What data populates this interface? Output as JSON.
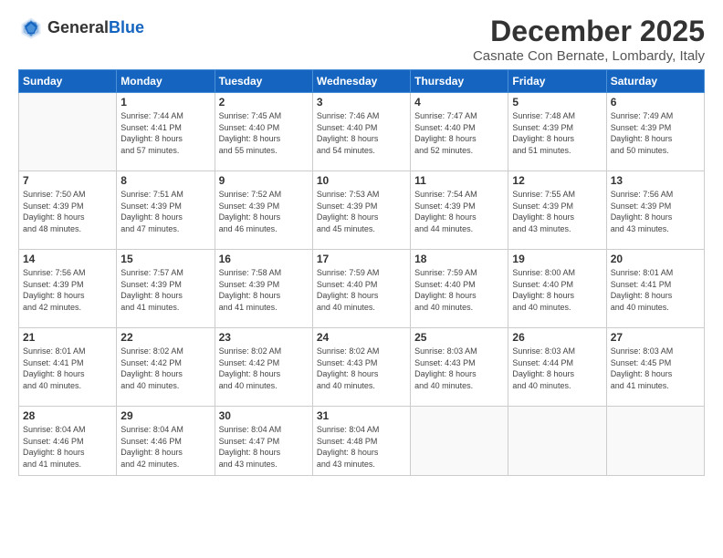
{
  "header": {
    "logo_general": "General",
    "logo_blue": "Blue",
    "month": "December 2025",
    "location": "Casnate Con Bernate, Lombardy, Italy"
  },
  "days_of_week": [
    "Sunday",
    "Monday",
    "Tuesday",
    "Wednesday",
    "Thursday",
    "Friday",
    "Saturday"
  ],
  "weeks": [
    [
      {
        "day": "",
        "info": ""
      },
      {
        "day": "1",
        "info": "Sunrise: 7:44 AM\nSunset: 4:41 PM\nDaylight: 8 hours\nand 57 minutes."
      },
      {
        "day": "2",
        "info": "Sunrise: 7:45 AM\nSunset: 4:40 PM\nDaylight: 8 hours\nand 55 minutes."
      },
      {
        "day": "3",
        "info": "Sunrise: 7:46 AM\nSunset: 4:40 PM\nDaylight: 8 hours\nand 54 minutes."
      },
      {
        "day": "4",
        "info": "Sunrise: 7:47 AM\nSunset: 4:40 PM\nDaylight: 8 hours\nand 52 minutes."
      },
      {
        "day": "5",
        "info": "Sunrise: 7:48 AM\nSunset: 4:39 PM\nDaylight: 8 hours\nand 51 minutes."
      },
      {
        "day": "6",
        "info": "Sunrise: 7:49 AM\nSunset: 4:39 PM\nDaylight: 8 hours\nand 50 minutes."
      }
    ],
    [
      {
        "day": "7",
        "info": "Sunrise: 7:50 AM\nSunset: 4:39 PM\nDaylight: 8 hours\nand 48 minutes."
      },
      {
        "day": "8",
        "info": "Sunrise: 7:51 AM\nSunset: 4:39 PM\nDaylight: 8 hours\nand 47 minutes."
      },
      {
        "day": "9",
        "info": "Sunrise: 7:52 AM\nSunset: 4:39 PM\nDaylight: 8 hours\nand 46 minutes."
      },
      {
        "day": "10",
        "info": "Sunrise: 7:53 AM\nSunset: 4:39 PM\nDaylight: 8 hours\nand 45 minutes."
      },
      {
        "day": "11",
        "info": "Sunrise: 7:54 AM\nSunset: 4:39 PM\nDaylight: 8 hours\nand 44 minutes."
      },
      {
        "day": "12",
        "info": "Sunrise: 7:55 AM\nSunset: 4:39 PM\nDaylight: 8 hours\nand 43 minutes."
      },
      {
        "day": "13",
        "info": "Sunrise: 7:56 AM\nSunset: 4:39 PM\nDaylight: 8 hours\nand 43 minutes."
      }
    ],
    [
      {
        "day": "14",
        "info": "Sunrise: 7:56 AM\nSunset: 4:39 PM\nDaylight: 8 hours\nand 42 minutes."
      },
      {
        "day": "15",
        "info": "Sunrise: 7:57 AM\nSunset: 4:39 PM\nDaylight: 8 hours\nand 41 minutes."
      },
      {
        "day": "16",
        "info": "Sunrise: 7:58 AM\nSunset: 4:39 PM\nDaylight: 8 hours\nand 41 minutes."
      },
      {
        "day": "17",
        "info": "Sunrise: 7:59 AM\nSunset: 4:40 PM\nDaylight: 8 hours\nand 40 minutes."
      },
      {
        "day": "18",
        "info": "Sunrise: 7:59 AM\nSunset: 4:40 PM\nDaylight: 8 hours\nand 40 minutes."
      },
      {
        "day": "19",
        "info": "Sunrise: 8:00 AM\nSunset: 4:40 PM\nDaylight: 8 hours\nand 40 minutes."
      },
      {
        "day": "20",
        "info": "Sunrise: 8:01 AM\nSunset: 4:41 PM\nDaylight: 8 hours\nand 40 minutes."
      }
    ],
    [
      {
        "day": "21",
        "info": "Sunrise: 8:01 AM\nSunset: 4:41 PM\nDaylight: 8 hours\nand 40 minutes."
      },
      {
        "day": "22",
        "info": "Sunrise: 8:02 AM\nSunset: 4:42 PM\nDaylight: 8 hours\nand 40 minutes."
      },
      {
        "day": "23",
        "info": "Sunrise: 8:02 AM\nSunset: 4:42 PM\nDaylight: 8 hours\nand 40 minutes."
      },
      {
        "day": "24",
        "info": "Sunrise: 8:02 AM\nSunset: 4:43 PM\nDaylight: 8 hours\nand 40 minutes."
      },
      {
        "day": "25",
        "info": "Sunrise: 8:03 AM\nSunset: 4:43 PM\nDaylight: 8 hours\nand 40 minutes."
      },
      {
        "day": "26",
        "info": "Sunrise: 8:03 AM\nSunset: 4:44 PM\nDaylight: 8 hours\nand 40 minutes."
      },
      {
        "day": "27",
        "info": "Sunrise: 8:03 AM\nSunset: 4:45 PM\nDaylight: 8 hours\nand 41 minutes."
      }
    ],
    [
      {
        "day": "28",
        "info": "Sunrise: 8:04 AM\nSunset: 4:46 PM\nDaylight: 8 hours\nand 41 minutes."
      },
      {
        "day": "29",
        "info": "Sunrise: 8:04 AM\nSunset: 4:46 PM\nDaylight: 8 hours\nand 42 minutes."
      },
      {
        "day": "30",
        "info": "Sunrise: 8:04 AM\nSunset: 4:47 PM\nDaylight: 8 hours\nand 43 minutes."
      },
      {
        "day": "31",
        "info": "Sunrise: 8:04 AM\nSunset: 4:48 PM\nDaylight: 8 hours\nand 43 minutes."
      },
      {
        "day": "",
        "info": ""
      },
      {
        "day": "",
        "info": ""
      },
      {
        "day": "",
        "info": ""
      }
    ]
  ]
}
